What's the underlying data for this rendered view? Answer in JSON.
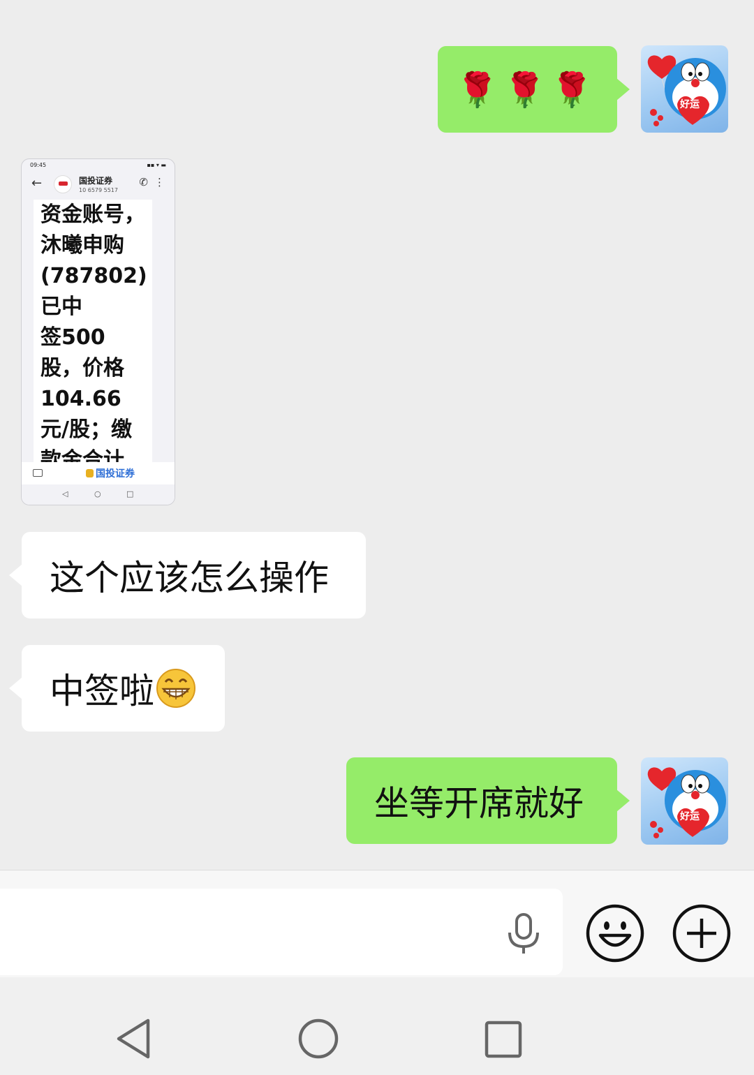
{
  "chat": {
    "top_hint": "",
    "messages": [
      {
        "side": "out",
        "type": "emoji",
        "text": "🌹🌹🌹"
      },
      {
        "side": "in",
        "type": "image"
      },
      {
        "side": "in",
        "type": "text",
        "text": "这个应该怎么操作"
      },
      {
        "side": "in",
        "type": "text",
        "text": "中签啦"
      },
      {
        "side": "out",
        "type": "text",
        "text": "坐等开席就好"
      }
    ]
  },
  "screenshot": {
    "status_time": "09:45",
    "sender": "国投证券",
    "sender_number": "10 6579 5517",
    "sms_lines": [
      "资金账号，",
      "沐曦申购",
      "(787802)",
      "已中",
      "签500",
      "股，价格",
      "104.66",
      "元/股；缴",
      "款金合计"
    ],
    "bottom_tag": "国投证券"
  },
  "avatar_badge": "好运",
  "icons": {
    "mic": "microphone-icon",
    "emoji": "smiley-icon",
    "plus": "plus-icon",
    "back": "back-triangle-icon",
    "home": "home-circle-icon",
    "recents": "recents-square-icon"
  },
  "colors": {
    "outgoing_bubble": "#95ec69",
    "incoming_bubble": "#ffffff",
    "background": "#ededed"
  }
}
